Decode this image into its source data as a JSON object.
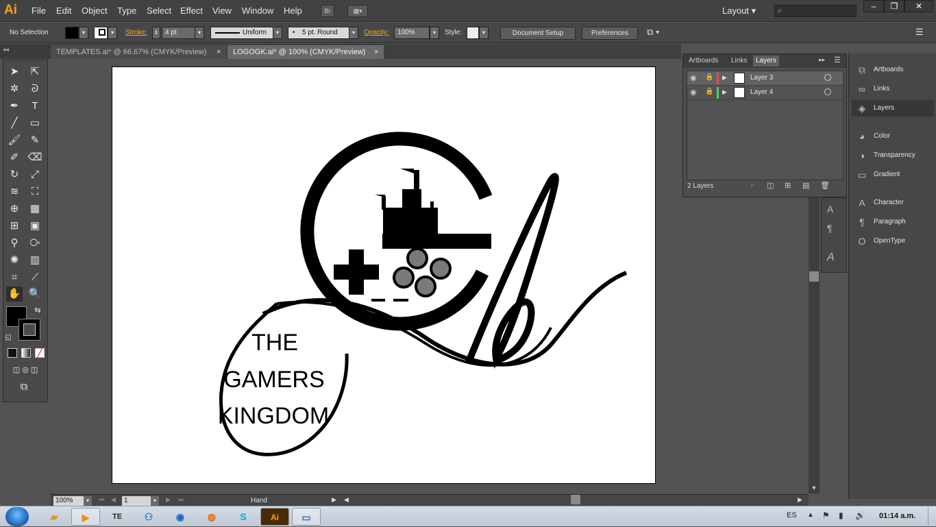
{
  "app": {
    "logo": "Ai",
    "workspace": "Layout"
  },
  "menu": [
    "File",
    "Edit",
    "Object",
    "Type",
    "Select",
    "Effect",
    "View",
    "Window",
    "Help"
  ],
  "menu_buttons": {
    "bridge": "Br"
  },
  "control_bar": {
    "selection": "No Selection",
    "stroke_label": "Stroke:",
    "stroke_weight": "4 pt",
    "stroke_profile": "Uniform",
    "brush": "5 pt. Round",
    "opacity_label": "Opacity:",
    "opacity": "100%",
    "style_label": "Style:",
    "document_setup": "Document Setup",
    "preferences": "Preferences"
  },
  "tabs": [
    {
      "title": "TEMPLATES.ai* @ 66.67% (CMYK/Preview)",
      "close": "×"
    },
    {
      "title": "LOGOGK.ai* @ 100% (CMYK/Preview)",
      "close": "×"
    }
  ],
  "artwork": {
    "logo_lines": [
      "THE",
      "GAMERS",
      "KINGDOM"
    ]
  },
  "status": {
    "zoom": "100%",
    "artboard_num": "1",
    "tool": "Hand"
  },
  "layers_panel": {
    "tabs": [
      "Artboards",
      "Links",
      "Layers"
    ],
    "layers": [
      {
        "name": "Layer 3",
        "color": "#e94b4b"
      },
      {
        "name": "Layer 4",
        "color": "#4ad35a"
      }
    ],
    "count": "2 Layers"
  },
  "dock": {
    "items": [
      "Artboards",
      "Links",
      "Layers",
      "Color",
      "Transparency",
      "Gradient",
      "Character",
      "Paragraph",
      "OpenType"
    ]
  },
  "taskbar": {
    "lang": "ES",
    "clock": "01:14 a.m.",
    "apps": [
      "TE",
      "Ai"
    ]
  }
}
